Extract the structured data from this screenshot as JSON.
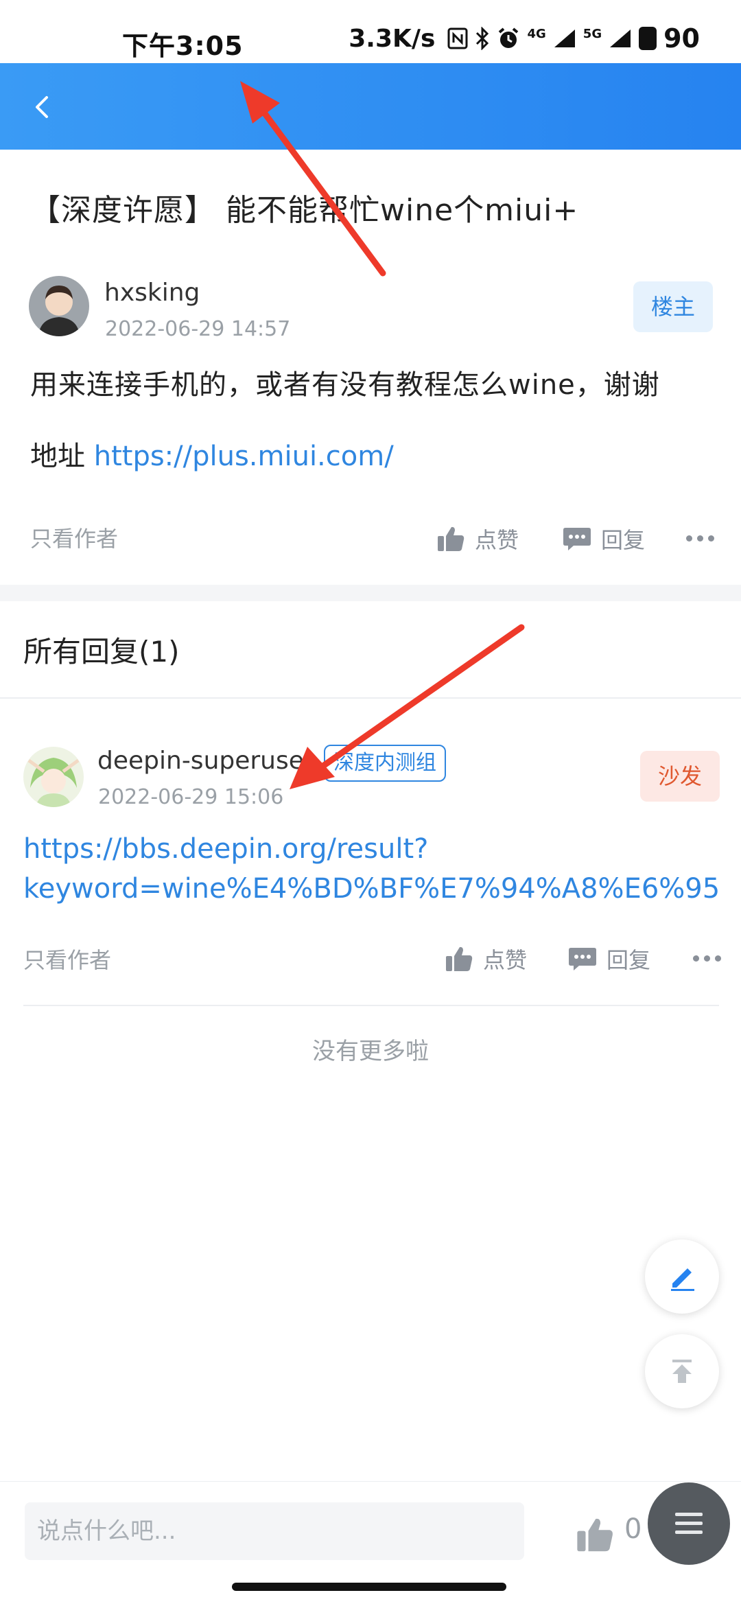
{
  "status_bar": {
    "time": "下午3:05",
    "net_speed": "3.3K/s",
    "net_4g": "4G",
    "net_5g": "5G",
    "battery": "90"
  },
  "post": {
    "title": "【深度许愿】 能不能帮忙wine个miui+",
    "author": "hxsking",
    "time": "2022-06-29 14:57",
    "host_badge": "楼主",
    "body": "用来连接手机的，或者有没有教程怎么wine，谢谢",
    "addr_label": "地址 ",
    "addr_link": "https://plus.miui.com/"
  },
  "actions": {
    "only_author": "只看作者",
    "like": "点赞",
    "reply": "回复"
  },
  "replies": {
    "title": "所有回复(1)",
    "items": [
      {
        "author": "deepin-superuser",
        "group": "深度内测组",
        "time": "2022-06-29 15:06",
        "badge": "沙发",
        "link_line1": "https://bbs.deepin.org/result?",
        "link_line2": "keyword=wine%E4%BD%BF%E7%94%A8%E6%95"
      }
    ],
    "no_more": "没有更多啦"
  },
  "bottom_bar": {
    "placeholder": "说点什么吧...",
    "like_count": "0"
  },
  "colors": {
    "header_blue": "#2683f0",
    "link_blue": "#2f86e0",
    "sofa_orange": "#e0582f",
    "arrow_red": "#ee3a2a"
  },
  "icons": [
    "back-arrow-icon",
    "thumb-up-icon",
    "comment-icon",
    "more-dots-icon",
    "edit-pen-icon",
    "back-to-top-icon",
    "menu-icon",
    "nfc-icon",
    "bluetooth-icon",
    "alarm-icon",
    "signal-icon",
    "battery-icon"
  ]
}
